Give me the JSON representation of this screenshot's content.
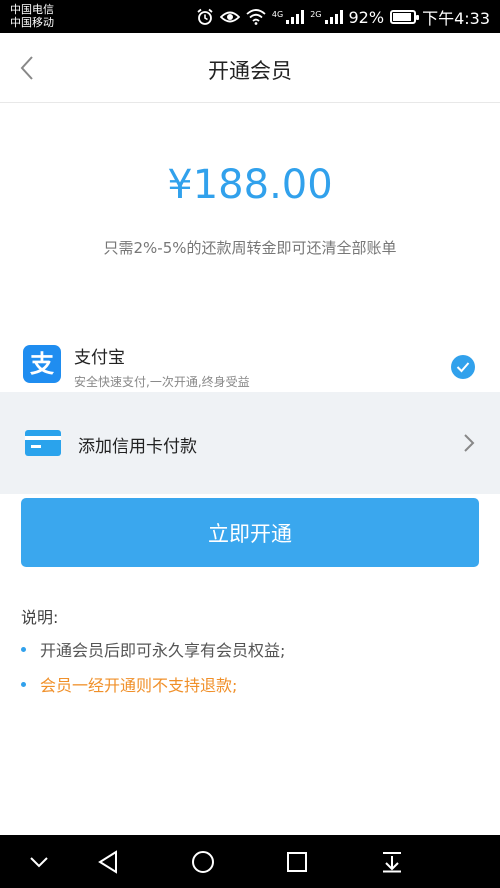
{
  "status_bar": {
    "carrier1": "中国电信",
    "carrier2": "中国移动",
    "signal1_tag": "4G",
    "signal2_tag": "2G",
    "battery_text": "92%",
    "battery_level": 0.92,
    "time": "下午4:33",
    "icons": [
      "alarm-icon",
      "eye-icon",
      "wifi-icon",
      "signal-icon",
      "signal-icon",
      "battery-icon"
    ]
  },
  "header": {
    "title": "开通会员",
    "back_icon": "chevron-left-icon"
  },
  "price": {
    "amount": "¥188.00",
    "description": "只需2%-5%的还款周转金即可还清全部账单"
  },
  "payment": {
    "alipay": {
      "logo_text": "支",
      "name": "支付宝",
      "subtitle": "安全快速支付,一次开通,终身受益",
      "selected": true
    },
    "card": {
      "label": "添加信用卡付款"
    }
  },
  "action": {
    "button_label": "立即开通"
  },
  "notes": {
    "title": "说明:",
    "items": [
      "开通会员后即可永久享有会员权益;",
      "会员一经开通则不支持退款;"
    ]
  },
  "colors": {
    "accent": "#3aa7ee",
    "price": "#31a1ec",
    "warning": "#f0902a"
  }
}
